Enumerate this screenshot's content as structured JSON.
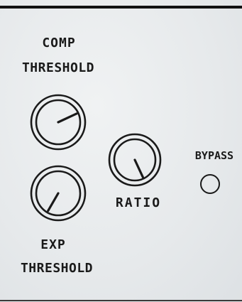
{
  "panel": {
    "comp_label_line1": "COMP",
    "comp_label_line2": "THRESHOLD",
    "exp_label_line1": "EXP",
    "exp_label_line2": "THRESHOLD",
    "ratio_label": "RATIO",
    "bypass_label": "BYPASS"
  },
  "knobs": {
    "comp_threshold": {
      "pointer_angle_deg": 65
    },
    "ratio": {
      "pointer_angle_deg": 155
    },
    "exp_threshold": {
      "pointer_angle_deg": 210
    }
  },
  "colors": {
    "ink": "#1a1a1a",
    "background": "#e9ecee"
  }
}
